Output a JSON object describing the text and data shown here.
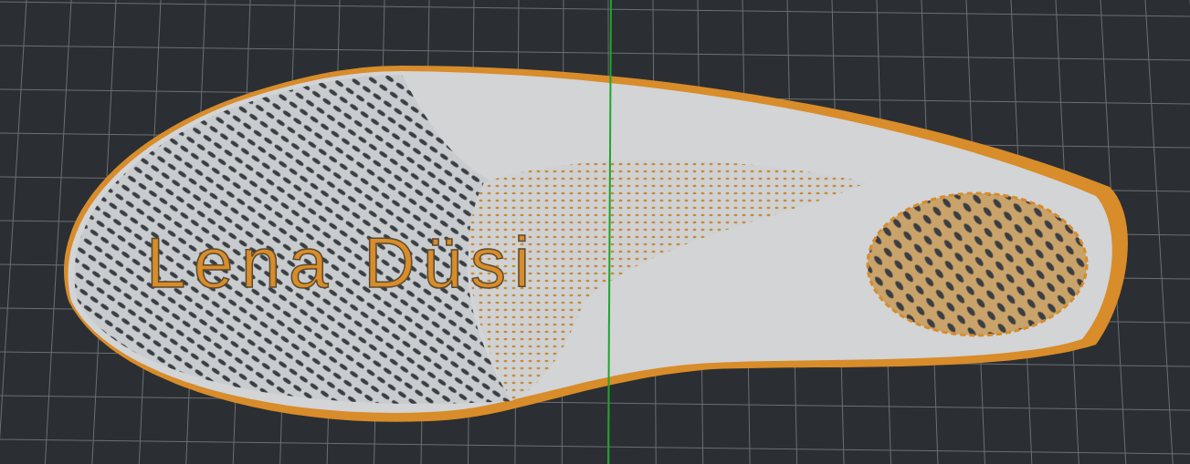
{
  "viewport": {
    "model_text": "Lena Düsi"
  }
}
